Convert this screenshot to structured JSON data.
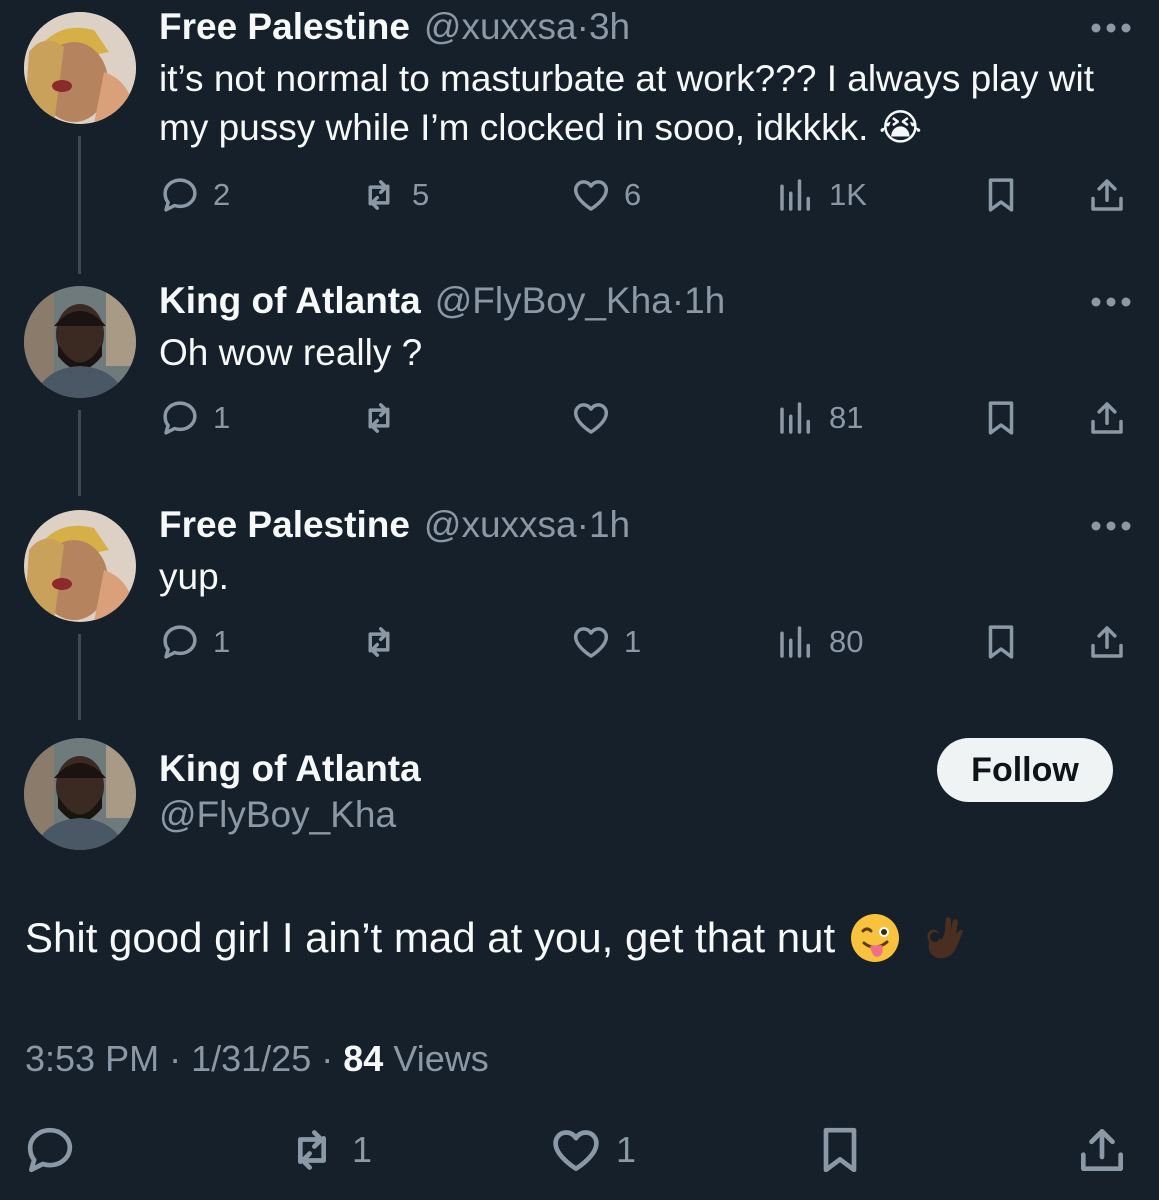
{
  "thread": [
    {
      "name": "Free Palestine",
      "handle": "@xuxxsa",
      "time": "3h",
      "text": "it’s not normal to masturbate at work??? I always play wit my pussy while I’m clocked in sooo, idkkkk. 😭",
      "replies": "2",
      "reposts": "5",
      "likes": "6",
      "views": "1K"
    },
    {
      "name": "King of Atlanta",
      "handle": "@FlyBoy_Kha",
      "time": "1h",
      "text": "Oh wow really ?",
      "replies": "1",
      "reposts": "",
      "likes": "",
      "views": "81"
    },
    {
      "name": "Free Palestine",
      "handle": "@xuxxsa",
      "time": "1h",
      "text": "yup.",
      "replies": "1",
      "reposts": "",
      "likes": "1",
      "views": "80"
    }
  ],
  "main": {
    "name": "King of Atlanta",
    "handle": "@FlyBoy_Kha",
    "follow_label": "Follow",
    "text": "Shit good girl I ain’t mad at you, get that nut",
    "emojis": [
      "winking-tongue-emoji",
      "ok-hand-emoji"
    ],
    "time": "3:53 PM",
    "date": "1/31/25",
    "views_count": "84",
    "views_label": "Views",
    "reposts": "1",
    "likes": "1"
  },
  "separator": "·",
  "colors": {
    "background": "#15202b",
    "text": "#f7f9f9",
    "muted": "#8b98a5",
    "thread_line": "#3d4a56",
    "follow_bg": "#eff3f4"
  }
}
